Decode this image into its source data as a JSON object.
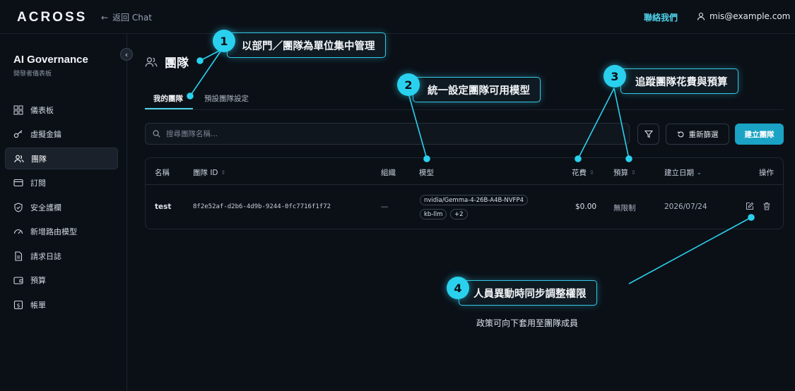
{
  "header": {
    "logo": "ACROSS",
    "back_label": "返回 Chat",
    "contact_label": "聯絡我們",
    "user_email": "mis@example.com"
  },
  "sidebar": {
    "title": "AI Governance",
    "subtitle": "開發者儀表板",
    "items": [
      {
        "label": "儀表板",
        "icon": "grid-icon"
      },
      {
        "label": "虛擬金鑰",
        "icon": "key-icon"
      },
      {
        "label": "團隊",
        "icon": "users-icon",
        "active": true
      },
      {
        "label": "訂閱",
        "icon": "card-icon"
      },
      {
        "label": "安全護欄",
        "icon": "shield-icon"
      },
      {
        "label": "新增路由模型",
        "icon": "gauge-icon"
      },
      {
        "label": "請求日誌",
        "icon": "file-icon"
      },
      {
        "label": "預算",
        "icon": "wallet-icon"
      },
      {
        "label": "帳單",
        "icon": "dollar-icon"
      }
    ]
  },
  "main": {
    "title": "團隊",
    "tabs": [
      {
        "label": "我的團隊",
        "active": true
      },
      {
        "label": "預設團隊設定",
        "active": false
      }
    ],
    "search_placeholder": "搜尋團隊名稱...",
    "reset_label": "重新篩選",
    "create_label": "建立團隊",
    "table": {
      "columns": [
        "名稱",
        "團隊 ID",
        "組織",
        "模型",
        "花費",
        "預算",
        "建立日期",
        "操作"
      ],
      "rows": [
        {
          "name": "test",
          "team_id": "8f2e52af-d2b6-4d9b-9244-0fc7716f1f72",
          "org": "—",
          "models": [
            "nvidia/Gemma-4-26B-A4B-NVFP4",
            "kb-llm",
            "+2"
          ],
          "spend": "$0.00",
          "budget": "無限制",
          "created": "2026/07/24"
        }
      ]
    }
  },
  "annotations": [
    {
      "number": "1",
      "text": "以部門／團隊為單位集中管理"
    },
    {
      "number": "2",
      "text": "統一設定團隊可用模型"
    },
    {
      "number": "3",
      "text": "追蹤團隊花費與預算"
    },
    {
      "number": "4",
      "text": "人員異動時同步調整權限"
    }
  ],
  "note": "政策可向下套用至團隊成員",
  "colors": {
    "accent": "#2ad1ee",
    "primary_button": "#1aa3c4",
    "background": "#0b1017"
  }
}
